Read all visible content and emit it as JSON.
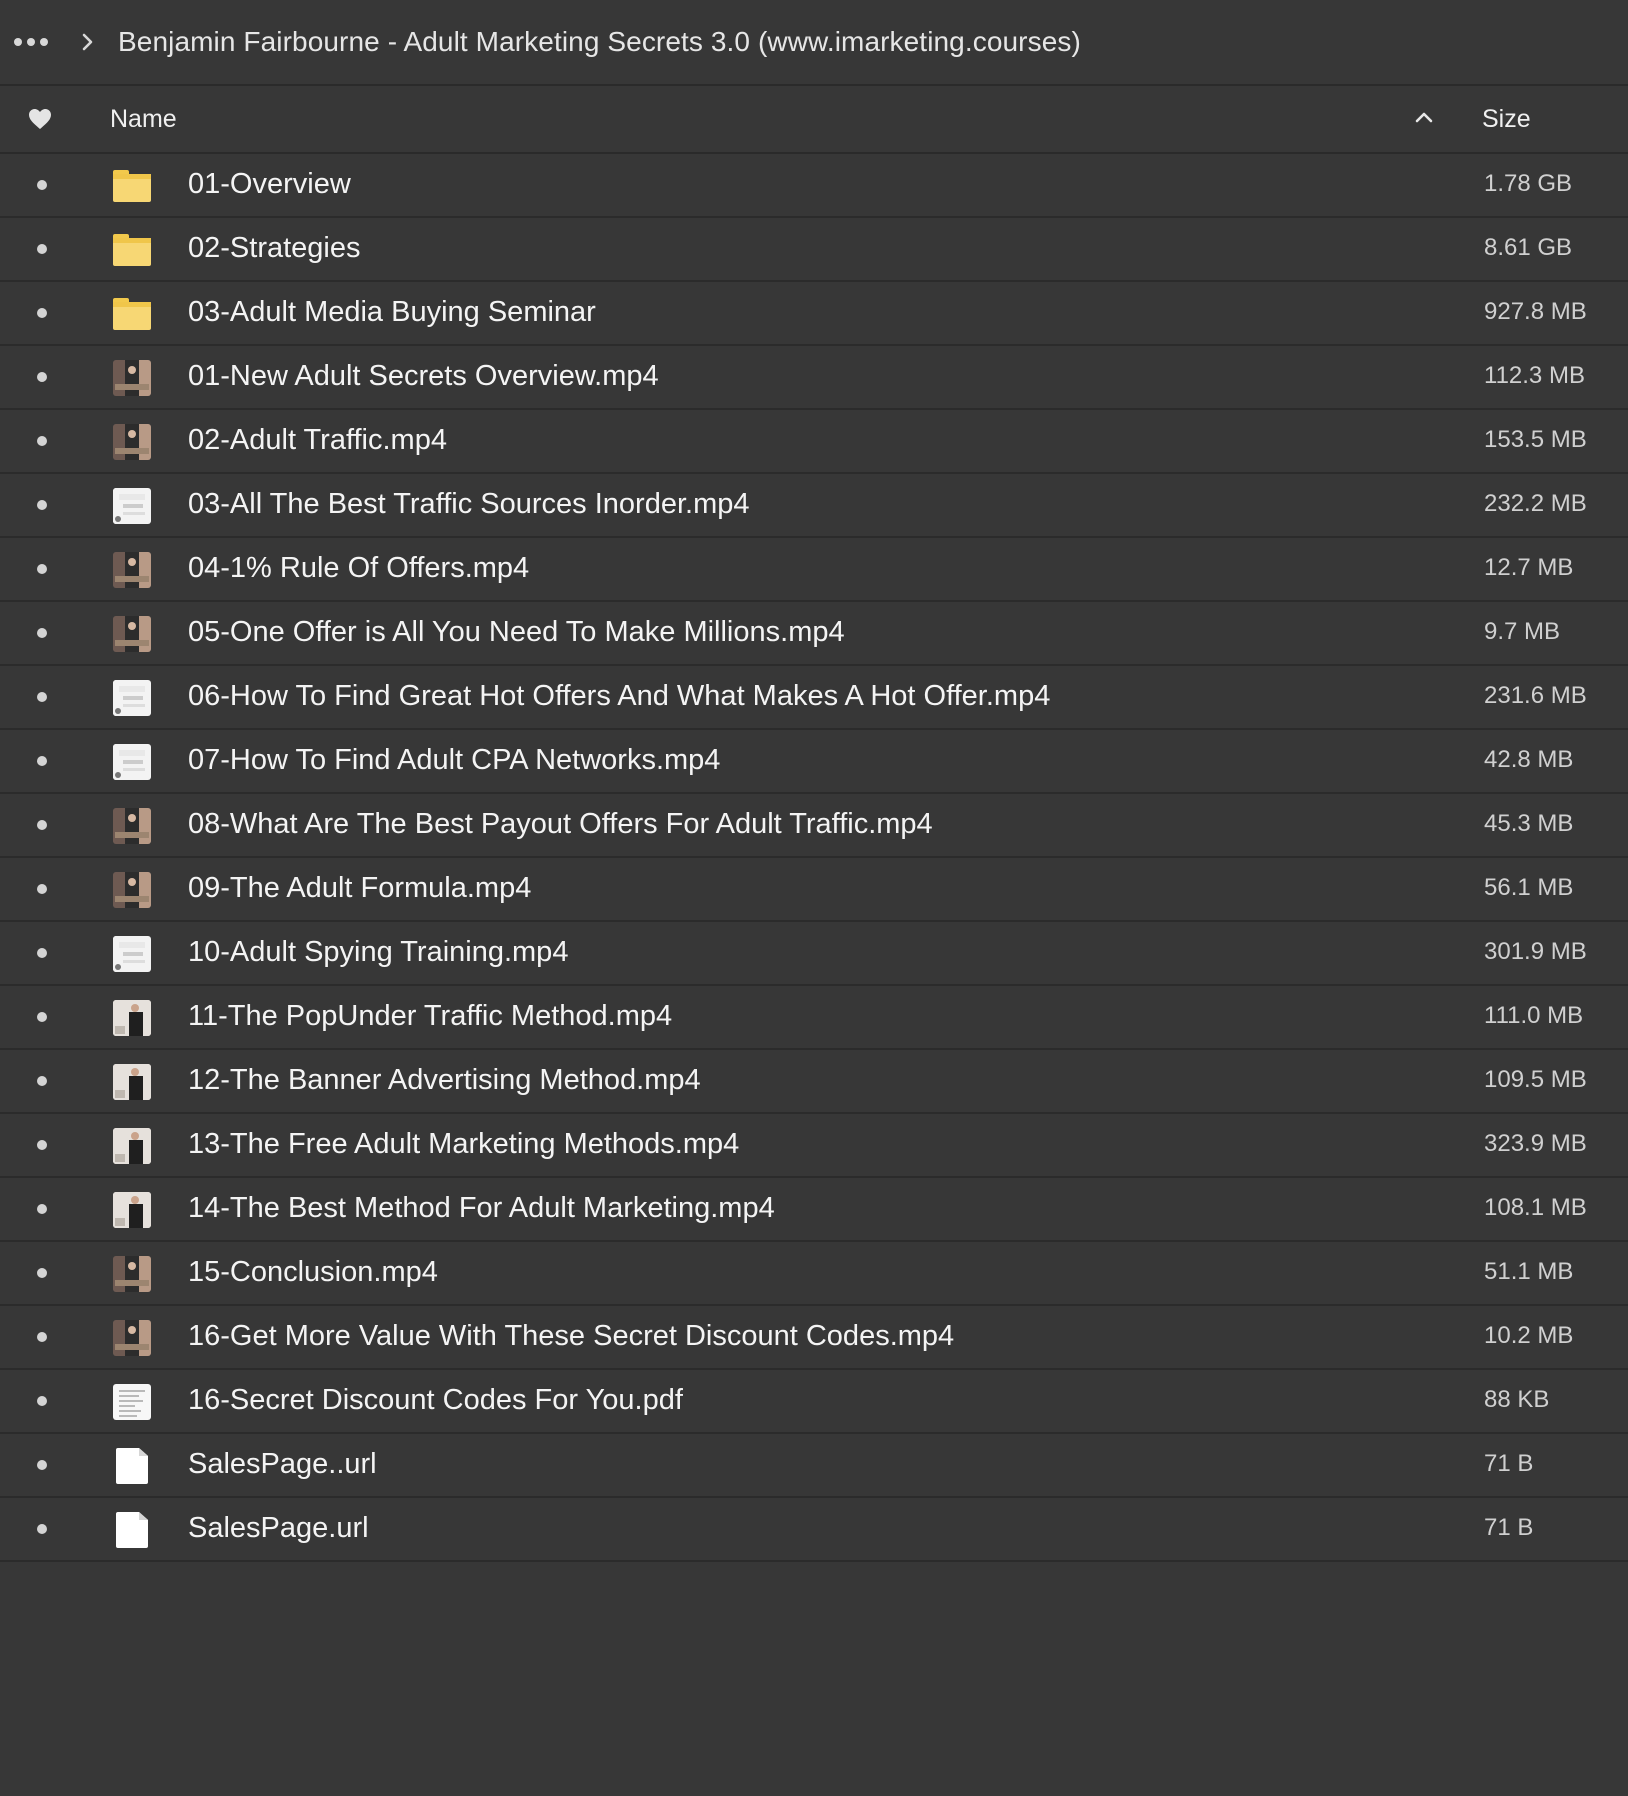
{
  "breadcrumb": {
    "more_label": "•••",
    "title": "Benjamin Fairbourne - Adult Marketing Secrets 3.0 (www.imarketing.courses)"
  },
  "header": {
    "name_label": "Name",
    "size_label": "Size",
    "sort_direction": "ascending"
  },
  "files": [
    {
      "name": "01-Overview",
      "size": "1.78 GB",
      "icon": "folder-icon"
    },
    {
      "name": "02-Strategies",
      "size": "8.61 GB",
      "icon": "folder-icon"
    },
    {
      "name": "03-Adult Media Buying Seminar",
      "size": "927.8 MB",
      "icon": "folder-icon"
    },
    {
      "name": "01-New Adult Secrets Overview.mp4",
      "size": "112.3 MB",
      "icon": "video-thumbnail-icon"
    },
    {
      "name": "02-Adult Traffic.mp4",
      "size": "153.5 MB",
      "icon": "video-thumbnail-icon"
    },
    {
      "name": "03-All The Best Traffic Sources Inorder.mp4",
      "size": "232.2 MB",
      "icon": "video-thumbnail-icon"
    },
    {
      "name": "04-1% Rule Of Offers.mp4",
      "size": "12.7 MB",
      "icon": "video-thumbnail-icon"
    },
    {
      "name": "05-One Offer is All You Need To Make Millions.mp4",
      "size": "9.7 MB",
      "icon": "video-thumbnail-icon"
    },
    {
      "name": "06-How To Find Great Hot Offers And What Makes A Hot Offer.mp4",
      "size": "231.6 MB",
      "icon": "video-thumbnail-icon"
    },
    {
      "name": "07-How To Find Adult CPA Networks.mp4",
      "size": "42.8 MB",
      "icon": "video-thumbnail-icon"
    },
    {
      "name": "08-What Are The Best Payout Offers For Adult Traffic.mp4",
      "size": "45.3 MB",
      "icon": "video-thumbnail-icon"
    },
    {
      "name": "09-The Adult Formula.mp4",
      "size": "56.1 MB",
      "icon": "video-thumbnail-icon"
    },
    {
      "name": "10-Adult Spying Training.mp4",
      "size": "301.9 MB",
      "icon": "video-thumbnail-icon"
    },
    {
      "name": "11-The PopUnder Traffic Method.mp4",
      "size": "111.0 MB",
      "icon": "video-thumbnail-icon"
    },
    {
      "name": "12-The Banner Advertising Method.mp4",
      "size": "109.5 MB",
      "icon": "video-thumbnail-icon"
    },
    {
      "name": "13-The Free Adult Marketing Methods.mp4",
      "size": "323.9 MB",
      "icon": "video-thumbnail-icon"
    },
    {
      "name": "14-The Best Method For Adult Marketing.mp4",
      "size": "108.1 MB",
      "icon": "video-thumbnail-icon"
    },
    {
      "name": "15-Conclusion.mp4",
      "size": "51.1 MB",
      "icon": "video-thumbnail-icon"
    },
    {
      "name": "16-Get More Value With These Secret Discount Codes.mp4",
      "size": "10.2 MB",
      "icon": "video-thumbnail-icon"
    },
    {
      "name": "16-Secret Discount Codes For You.pdf",
      "size": "88 KB",
      "icon": "document-icon"
    },
    {
      "name": "SalesPage..url",
      "size": "71 B",
      "icon": "blank-file-icon"
    },
    {
      "name": "SalesPage.url",
      "size": "71 B",
      "icon": "blank-file-icon"
    }
  ],
  "colors": {
    "background": "#373737",
    "divider": "#2b2b2b",
    "text": "#f4f4f4",
    "muted_text": "#d0d0d0",
    "folder": "#f7d774"
  }
}
